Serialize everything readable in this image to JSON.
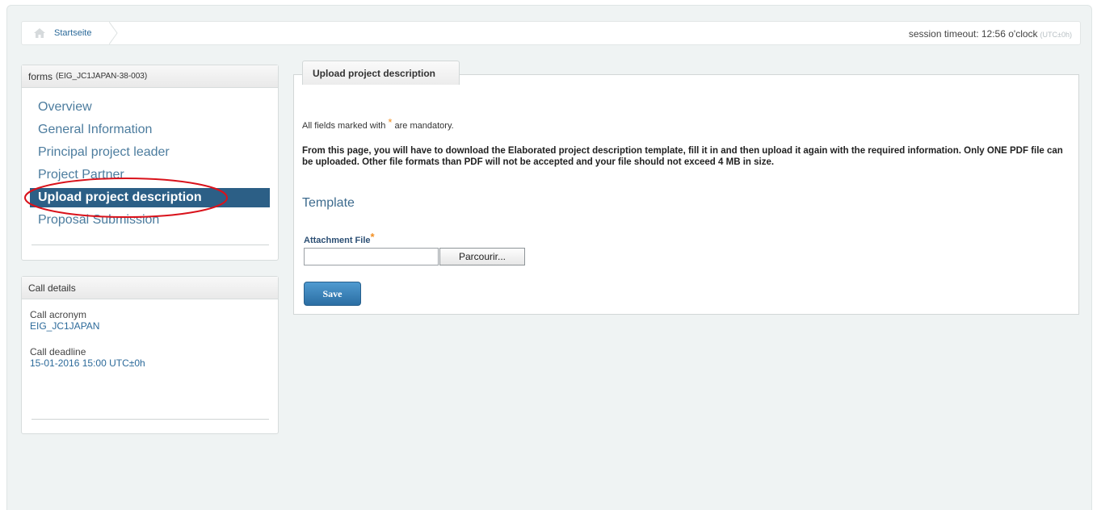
{
  "breadcrumb": {
    "home_label": "Startseite"
  },
  "session": {
    "text": "session timeout: 12:56 o'clock",
    "tz": "(UTC±0h)"
  },
  "forms_panel": {
    "title": "forms",
    "code": "(EIG_JC1JAPAN-38-003)",
    "items": [
      {
        "label": "Overview"
      },
      {
        "label": "General Information"
      },
      {
        "label": "Principal project leader"
      },
      {
        "label": "Project Partner"
      },
      {
        "label": "Upload project description",
        "active": true
      },
      {
        "label": "Proposal Submission"
      }
    ]
  },
  "call_details": {
    "title": "Call details",
    "acronym_label": "Call acronym",
    "acronym_value": "EIG_JC1JAPAN",
    "deadline_label": "Call deadline",
    "deadline_value": "15-01-2016 15:00 UTC±0h"
  },
  "main": {
    "tab_label": "Upload project description",
    "mandatory_prefix": "All fields marked with",
    "mandatory_star": "*",
    "mandatory_suffix": "are mandatory.",
    "instructions": "From this page, you will have to download the Elaborated project description template, fill it in and then upload it again with the required information. Only ONE PDF file can be uploaded. Other file formats than PDF will not be accepted and your file should not exceed 4 MB in size.",
    "template_title": "Template",
    "attachment_label": "Attachment File",
    "attachment_star": "*",
    "browse_label": "Parcourir...",
    "save_label": "Save"
  },
  "colors": {
    "accent": "#2c5f86",
    "link": "#2c6a9a",
    "required_star": "#f28f22",
    "annotation": "#d9121b"
  }
}
